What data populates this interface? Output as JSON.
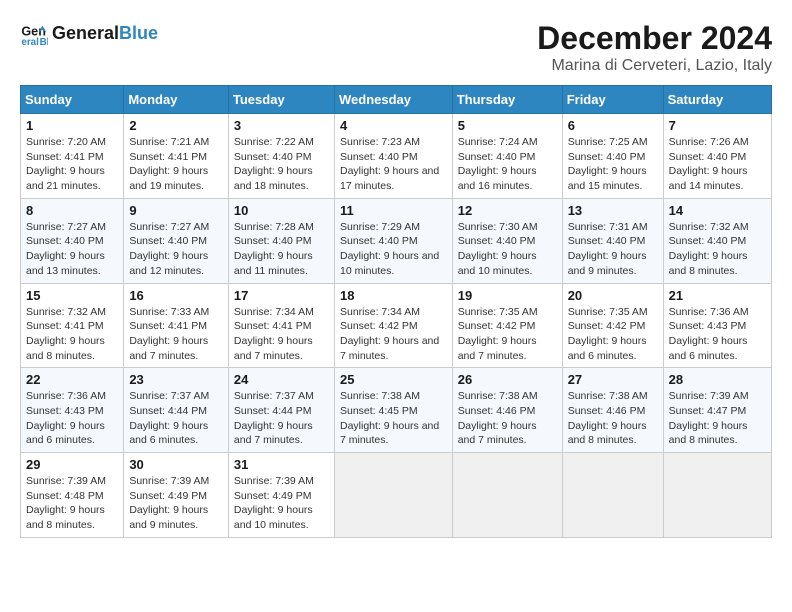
{
  "logo": {
    "line1": "General",
    "line2": "Blue"
  },
  "title": "December 2024",
  "subtitle": "Marina di Cerveteri, Lazio, Italy",
  "days_of_week": [
    "Sunday",
    "Monday",
    "Tuesday",
    "Wednesday",
    "Thursday",
    "Friday",
    "Saturday"
  ],
  "weeks": [
    [
      {
        "day": "1",
        "sunrise": "7:20 AM",
        "sunset": "4:41 PM",
        "daylight": "9 hours and 21 minutes."
      },
      {
        "day": "2",
        "sunrise": "7:21 AM",
        "sunset": "4:41 PM",
        "daylight": "9 hours and 19 minutes."
      },
      {
        "day": "3",
        "sunrise": "7:22 AM",
        "sunset": "4:40 PM",
        "daylight": "9 hours and 18 minutes."
      },
      {
        "day": "4",
        "sunrise": "7:23 AM",
        "sunset": "4:40 PM",
        "daylight": "9 hours and 17 minutes."
      },
      {
        "day": "5",
        "sunrise": "7:24 AM",
        "sunset": "4:40 PM",
        "daylight": "9 hours and 16 minutes."
      },
      {
        "day": "6",
        "sunrise": "7:25 AM",
        "sunset": "4:40 PM",
        "daylight": "9 hours and 15 minutes."
      },
      {
        "day": "7",
        "sunrise": "7:26 AM",
        "sunset": "4:40 PM",
        "daylight": "9 hours and 14 minutes."
      }
    ],
    [
      {
        "day": "8",
        "sunrise": "7:27 AM",
        "sunset": "4:40 PM",
        "daylight": "9 hours and 13 minutes."
      },
      {
        "day": "9",
        "sunrise": "7:27 AM",
        "sunset": "4:40 PM",
        "daylight": "9 hours and 12 minutes."
      },
      {
        "day": "10",
        "sunrise": "7:28 AM",
        "sunset": "4:40 PM",
        "daylight": "9 hours and 11 minutes."
      },
      {
        "day": "11",
        "sunrise": "7:29 AM",
        "sunset": "4:40 PM",
        "daylight": "9 hours and 10 minutes."
      },
      {
        "day": "12",
        "sunrise": "7:30 AM",
        "sunset": "4:40 PM",
        "daylight": "9 hours and 10 minutes."
      },
      {
        "day": "13",
        "sunrise": "7:31 AM",
        "sunset": "4:40 PM",
        "daylight": "9 hours and 9 minutes."
      },
      {
        "day": "14",
        "sunrise": "7:32 AM",
        "sunset": "4:40 PM",
        "daylight": "9 hours and 8 minutes."
      }
    ],
    [
      {
        "day": "15",
        "sunrise": "7:32 AM",
        "sunset": "4:41 PM",
        "daylight": "9 hours and 8 minutes."
      },
      {
        "day": "16",
        "sunrise": "7:33 AM",
        "sunset": "4:41 PM",
        "daylight": "9 hours and 7 minutes."
      },
      {
        "day": "17",
        "sunrise": "7:34 AM",
        "sunset": "4:41 PM",
        "daylight": "9 hours and 7 minutes."
      },
      {
        "day": "18",
        "sunrise": "7:34 AM",
        "sunset": "4:42 PM",
        "daylight": "9 hours and 7 minutes."
      },
      {
        "day": "19",
        "sunrise": "7:35 AM",
        "sunset": "4:42 PM",
        "daylight": "9 hours and 7 minutes."
      },
      {
        "day": "20",
        "sunrise": "7:35 AM",
        "sunset": "4:42 PM",
        "daylight": "9 hours and 6 minutes."
      },
      {
        "day": "21",
        "sunrise": "7:36 AM",
        "sunset": "4:43 PM",
        "daylight": "9 hours and 6 minutes."
      }
    ],
    [
      {
        "day": "22",
        "sunrise": "7:36 AM",
        "sunset": "4:43 PM",
        "daylight": "9 hours and 6 minutes."
      },
      {
        "day": "23",
        "sunrise": "7:37 AM",
        "sunset": "4:44 PM",
        "daylight": "9 hours and 6 minutes."
      },
      {
        "day": "24",
        "sunrise": "7:37 AM",
        "sunset": "4:44 PM",
        "daylight": "9 hours and 7 minutes."
      },
      {
        "day": "25",
        "sunrise": "7:38 AM",
        "sunset": "4:45 PM",
        "daylight": "9 hours and 7 minutes."
      },
      {
        "day": "26",
        "sunrise": "7:38 AM",
        "sunset": "4:46 PM",
        "daylight": "9 hours and 7 minutes."
      },
      {
        "day": "27",
        "sunrise": "7:38 AM",
        "sunset": "4:46 PM",
        "daylight": "9 hours and 8 minutes."
      },
      {
        "day": "28",
        "sunrise": "7:39 AM",
        "sunset": "4:47 PM",
        "daylight": "9 hours and 8 minutes."
      }
    ],
    [
      {
        "day": "29",
        "sunrise": "7:39 AM",
        "sunset": "4:48 PM",
        "daylight": "9 hours and 8 minutes."
      },
      {
        "day": "30",
        "sunrise": "7:39 AM",
        "sunset": "4:49 PM",
        "daylight": "9 hours and 9 minutes."
      },
      {
        "day": "31",
        "sunrise": "7:39 AM",
        "sunset": "4:49 PM",
        "daylight": "9 hours and 10 minutes."
      },
      null,
      null,
      null,
      null
    ]
  ],
  "labels": {
    "sunrise": "Sunrise:",
    "sunset": "Sunset:",
    "daylight": "Daylight:"
  }
}
